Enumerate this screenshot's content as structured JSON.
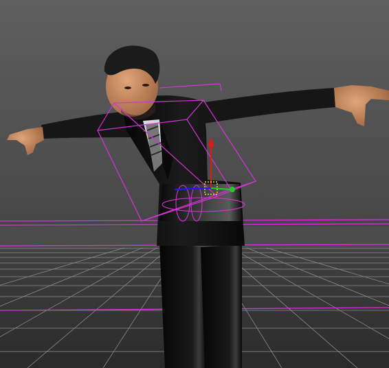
{
  "viewport": {
    "camera": "perspective",
    "background_top": "#5f5f5f",
    "background_bottom": "#2a2a2a",
    "grid_color": "#8a8a8a",
    "highlight_color": "#d633d6"
  },
  "character": {
    "suit_color": "#121212",
    "skin_color": "#c98a5c",
    "hair_color": "#1b1b1b"
  },
  "manipulator": {
    "x_axis_color": "#1a1aff",
    "y_axis_color": "#e01a1a",
    "z_axis_color": "#20d020",
    "center_color": "#e6e633"
  }
}
